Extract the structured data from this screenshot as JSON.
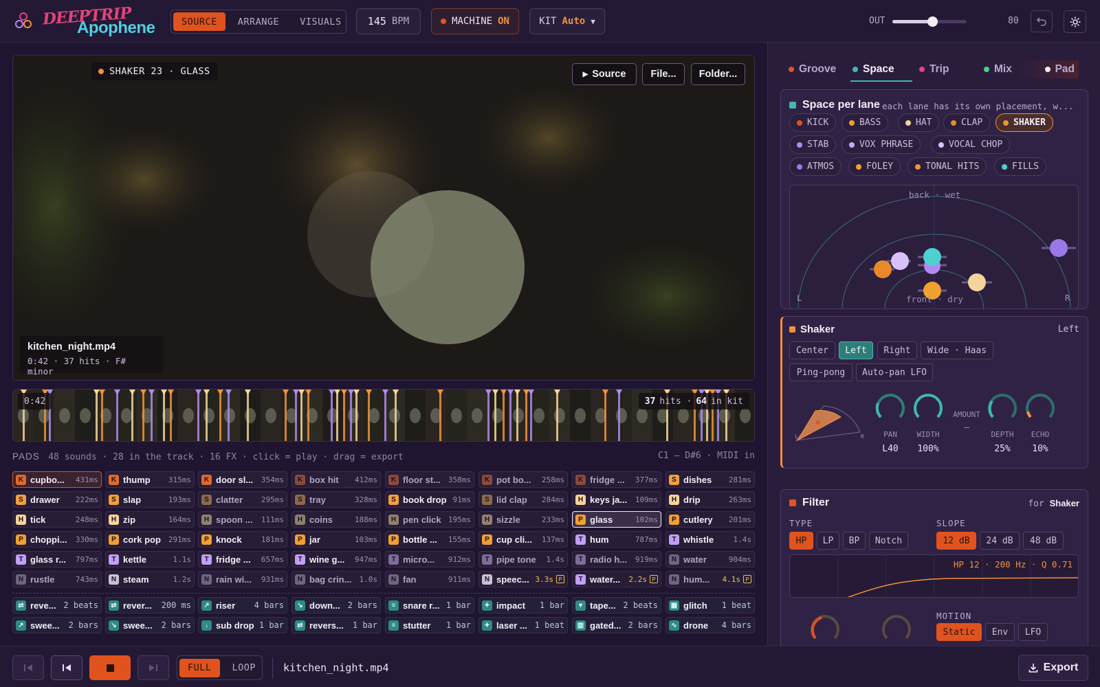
{
  "app": {
    "logo_top": "DEEPTRIP",
    "logo_bottom": "Apophene"
  },
  "modes": [
    {
      "label": "SOURCE",
      "active": true
    },
    {
      "label": "ARRANGE",
      "active": false
    },
    {
      "label": "VISUALS",
      "active": false
    }
  ],
  "bpm": {
    "value": "145",
    "unit": "BPM"
  },
  "machine": {
    "label": "MACHINE",
    "state": "ON"
  },
  "kit": {
    "label": "KIT",
    "value": "Auto"
  },
  "out": {
    "label": "OUT",
    "value": "80",
    "level": 0.8
  },
  "video": {
    "tag": "SHAKER 23 · GLASS",
    "source_btn": "Source",
    "file_btn": "File...",
    "folder_btn": "Folder...",
    "filename": "kitchen_night.mp4",
    "meta": "0:42 · 37 hits · F# minor"
  },
  "strip": {
    "time": "0:42",
    "hits": "37",
    "hits_label": "hits ·",
    "kit_count": "64",
    "kit_label": "in kit"
  },
  "pads_header": {
    "title": "PADS",
    "info": "48 sounds · 28 in the track · 16 FX · click = play · drag = export",
    "midi": "C1 – D#6 · MIDI in"
  },
  "pads": [
    [
      {
        "b": "K",
        "n": "cupbo...",
        "d": "431ms",
        "t": "k",
        "sel": "o"
      },
      {
        "b": "K",
        "n": "thump",
        "d": "315ms",
        "t": "k"
      },
      {
        "b": "K",
        "n": "door sl...",
        "d": "354ms",
        "t": "k"
      },
      {
        "b": "K",
        "n": "box hit",
        "d": "412ms",
        "t": "kd"
      },
      {
        "b": "K",
        "n": "floor st...",
        "d": "358ms",
        "t": "kd"
      },
      {
        "b": "K",
        "n": "pot bo...",
        "d": "258ms",
        "t": "kd"
      },
      {
        "b": "K",
        "n": "fridge ...",
        "d": "377ms",
        "t": "kd"
      },
      {
        "b": "S",
        "n": "dishes",
        "d": "281ms",
        "t": "s"
      }
    ],
    [
      {
        "b": "S",
        "n": "drawer",
        "d": "222ms",
        "t": "s"
      },
      {
        "b": "S",
        "n": "slap",
        "d": "193ms",
        "t": "s"
      },
      {
        "b": "S",
        "n": "clatter",
        "d": "295ms",
        "t": "sd"
      },
      {
        "b": "S",
        "n": "tray",
        "d": "328ms",
        "t": "sd"
      },
      {
        "b": "S",
        "n": "book drop",
        "d": "91ms",
        "t": "s"
      },
      {
        "b": "S",
        "n": "lid clap",
        "d": "284ms",
        "t": "sd"
      },
      {
        "b": "H",
        "n": "keys ja...",
        "d": "109ms",
        "t": "h"
      },
      {
        "b": "H",
        "n": "drip",
        "d": "263ms",
        "t": "h"
      }
    ],
    [
      {
        "b": "H",
        "n": "tick",
        "d": "248ms",
        "t": "h"
      },
      {
        "b": "H",
        "n": "zip",
        "d": "164ms",
        "t": "h"
      },
      {
        "b": "H",
        "n": "spoon ...",
        "d": "111ms",
        "t": "hd"
      },
      {
        "b": "H",
        "n": "coins",
        "d": "188ms",
        "t": "hd"
      },
      {
        "b": "H",
        "n": "pen click",
        "d": "195ms",
        "t": "hd"
      },
      {
        "b": "H",
        "n": "sizzle",
        "d": "233ms",
        "t": "hd"
      },
      {
        "b": "P",
        "n": "glass",
        "d": "102ms",
        "t": "p",
        "sel": "w"
      },
      {
        "b": "P",
        "n": "cutlery",
        "d": "201ms",
        "t": "p"
      }
    ],
    [
      {
        "b": "P",
        "n": "choppi...",
        "d": "330ms",
        "t": "p"
      },
      {
        "b": "P",
        "n": "cork pop",
        "d": "291ms",
        "t": "p"
      },
      {
        "b": "P",
        "n": "knock",
        "d": "181ms",
        "t": "p"
      },
      {
        "b": "P",
        "n": "jar",
        "d": "103ms",
        "t": "p"
      },
      {
        "b": "P",
        "n": "bottle ...",
        "d": "155ms",
        "t": "p"
      },
      {
        "b": "P",
        "n": "cup cli...",
        "d": "137ms",
        "t": "p"
      },
      {
        "b": "T",
        "n": "hum",
        "d": "787ms",
        "t": "t"
      },
      {
        "b": "T",
        "n": "whistle",
        "d": "1.4s",
        "t": "t"
      }
    ],
    [
      {
        "b": "T",
        "n": "glass r...",
        "d": "797ms",
        "t": "t"
      },
      {
        "b": "T",
        "n": "kettle",
        "d": "1.1s",
        "t": "t"
      },
      {
        "b": "T",
        "n": "fridge ...",
        "d": "657ms",
        "t": "t"
      },
      {
        "b": "T",
        "n": "wine g...",
        "d": "947ms",
        "t": "t"
      },
      {
        "b": "T",
        "n": "micro...",
        "d": "912ms",
        "t": "td"
      },
      {
        "b": "T",
        "n": "pipe tone",
        "d": "1.4s",
        "t": "td"
      },
      {
        "b": "T",
        "n": "radio h...",
        "d": "919ms",
        "t": "td"
      },
      {
        "b": "N",
        "n": "water",
        "d": "904ms",
        "t": "nd"
      }
    ],
    [
      {
        "b": "N",
        "n": "rustle",
        "d": "743ms",
        "t": "nd"
      },
      {
        "b": "N",
        "n": "steam",
        "d": "1.2s",
        "t": "n"
      },
      {
        "b": "N",
        "n": "rain wi...",
        "d": "931ms",
        "t": "nd"
      },
      {
        "b": "N",
        "n": "bag crin...",
        "d": "1.0s",
        "t": "nd"
      },
      {
        "b": "N",
        "n": "fan",
        "d": "911ms",
        "t": "nd"
      },
      {
        "b": "N",
        "n": "speec...",
        "d": "3.3s",
        "t": "n",
        "p": true
      },
      {
        "b": "T",
        "n": "water...",
        "d": "2.2s",
        "t": "t",
        "p": true
      },
      {
        "b": "N",
        "n": "hum...",
        "d": "4.1s",
        "t": "nd",
        "p": true
      }
    ]
  ],
  "fx": [
    [
      {
        "i": "⇄",
        "n": "reve...",
        "d": "2 beats"
      },
      {
        "i": "⇄",
        "n": "rever...",
        "d": "200 ms"
      },
      {
        "i": "↗",
        "n": "riser",
        "d": "4 bars"
      },
      {
        "i": "↘",
        "n": "down...",
        "d": "2 bars"
      },
      {
        "i": "≡",
        "n": "snare r...",
        "d": "1 bar"
      },
      {
        "i": "✦",
        "n": "impact",
        "d": "1 bar"
      },
      {
        "i": "▾",
        "n": "tape...",
        "d": "2 beats"
      },
      {
        "i": "▦",
        "n": "glitch",
        "d": "1 beat"
      }
    ],
    [
      {
        "i": "↗",
        "n": "swee...",
        "d": "2 bars"
      },
      {
        "i": "↘",
        "n": "swee...",
        "d": "2 bars"
      },
      {
        "i": "↓",
        "n": "sub drop",
        "d": "1 bar"
      },
      {
        "i": "⇄",
        "n": "revers...",
        "d": "1 bar"
      },
      {
        "i": "≡",
        "n": "stutter",
        "d": "1 bar"
      },
      {
        "i": "✦",
        "n": "laser ...",
        "d": "1 beat"
      },
      {
        "i": "▥",
        "n": "gated...",
        "d": "2 bars"
      },
      {
        "i": "∿",
        "n": "drone",
        "d": "4 bars"
      }
    ]
  ],
  "right_tabs": [
    {
      "label": "Groove",
      "color": "#e0531f"
    },
    {
      "label": "Space",
      "color": "#3fb8b0",
      "active": true
    },
    {
      "label": "Trip",
      "color": "#e0457a"
    },
    {
      "label": "Mix",
      "color": "#4fd08a"
    },
    {
      "label": "Pad",
      "color": "#f3ecf8"
    }
  ],
  "space": {
    "title": "Space per lane",
    "subtitle": "each lane has its own placement, w...",
    "lanes": [
      {
        "label": "KICK",
        "color": "#e0531f"
      },
      {
        "label": "BASS",
        "color": "#f0a030"
      },
      {
        "label": "HAT",
        "color": "#f5d49a"
      },
      {
        "label": "CLAP",
        "color": "#e88a2a"
      },
      {
        "label": "SHAKER",
        "color": "#f0923a",
        "active": true
      },
      {
        "label": "STAB",
        "color": "#b08af0"
      },
      {
        "label": "VOX PHRASE",
        "color": "#c8a8f8"
      },
      {
        "label": "VOCAL CHOP",
        "color": "#d8c0f8"
      },
      {
        "label": "ATMOS",
        "color": "#9a78e8"
      },
      {
        "label": "FOLEY",
        "color": "#f0a030"
      },
      {
        "label": "TONAL HITS",
        "color": "#f0923a"
      },
      {
        "label": "FILLS",
        "color": "#4fd0d0"
      }
    ],
    "field": {
      "top_label": "back · wet",
      "bottom_label": "front · dry",
      "left": "L",
      "right": "R"
    }
  },
  "shaker": {
    "title": "Shaker",
    "placement": "Left",
    "modes": [
      "Center",
      "Left",
      "Right",
      "Wide · Haas",
      "Ping-pong",
      "Auto-pan LFO"
    ],
    "active_mode": "Left",
    "knobs": [
      {
        "label": "PAN",
        "value": "L40"
      },
      {
        "label": "WIDTH",
        "value": "100%"
      },
      {
        "label": "AMOUNT",
        "value": "—"
      },
      {
        "label": "DEPTH",
        "value": "25%"
      },
      {
        "label": "ECHO",
        "value": "10%"
      }
    ],
    "pan_l": "L",
    "pan_r": "R"
  },
  "filter": {
    "title": "Filter",
    "for_label": "for",
    "target": "Shaker",
    "type_label": "TYPE",
    "types": [
      "HP",
      "LP",
      "BP",
      "Notch"
    ],
    "active_type": "HP",
    "slope_label": "SLOPE",
    "slopes": [
      "12 dB",
      "24 dB",
      "48 dB"
    ],
    "active_slope": "12 dB",
    "readout": "HP 12 · 200 Hz · Q 0.71",
    "motion_label": "MOTION",
    "motions": [
      "Static",
      "Env",
      "LFO"
    ]
  },
  "bottom": {
    "full": "FULL",
    "loop": "LOOP",
    "filename": "kitchen_night.mp4",
    "export": "Export"
  },
  "colors": {
    "accent": "#e0531f",
    "teal": "#3fb8b0",
    "kick": "#e0531f",
    "snare": "#f0a030",
    "hat": "#f5d49a",
    "perc": "#f0923a",
    "tonal": "#b08af0",
    "noise": "#9a8cab"
  }
}
